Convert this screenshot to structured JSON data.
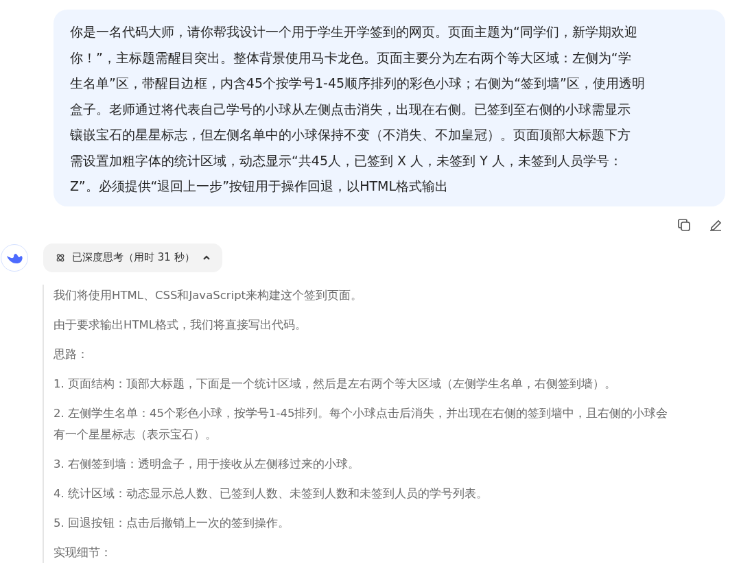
{
  "user_message": {
    "lines": [
      "你是一名代码大师，请你帮我设计一个用于学生开学签到的网页。页面主题为“同学们，新学期欢迎",
      "你！”，主标题需醒目突出。整体背景使用马卡龙色。页面主要分为左右两个等大区域：左侧为“学",
      "生名单”区，带醒目边框，内含45个按学号1-45顺序排列的彩色小球；右侧为“签到墙”区，使用透明",
      "盒子。老师通过将代表自己学号的小球从左侧点击消失，出现在右侧。已签到至右侧的小球需显示",
      "镶嵌宝石的星星标志，但左侧名单中的小球保持不变（不消失、不加皇冠）。页面顶部大标题下方",
      "需设置加粗字体的统计区域，动态显示“共45人，已签到 X 人，未签到 Y 人，未签到人员学号：",
      "Z”。必须提供“退回上一步”按钮用于操作回退，以HTML格式输出"
    ]
  },
  "thinking_toggle": {
    "label": "已深度思考（用时 31 秒）",
    "expanded": true
  },
  "thinking": [
    {
      "lines": [
        "我们将使用HTML、CSS和JavaScript来构建这个签到页面。"
      ]
    },
    {
      "lines": [
        "由于要求输出HTML格式，我们将直接写出代码。"
      ]
    },
    {
      "lines": [
        "思路："
      ]
    },
    {
      "lines": [
        "1. 页面结构：顶部大标题，下面是一个统计区域，然后是左右两个等大区域（左侧学生名单，右侧签到墙）。"
      ]
    },
    {
      "lines": [
        "2. 左侧学生名单：45个彩色小球，按学号1-45排列。每个小球点击后消失，并出现在右侧的签到墙中，且右侧的小球会",
        "有一个星星标志（表示宝石）。"
      ]
    },
    {
      "lines": [
        "3. 右侧签到墙：透明盒子，用于接收从左侧移过来的小球。"
      ]
    },
    {
      "lines": [
        "4. 统计区域：动态显示总人数、已签到人数、未签到人数和未签到人员的学号列表。"
      ]
    },
    {
      "lines": [
        "5. 回退按钮：点击后撤销上一次的签到操作。"
      ]
    },
    {
      "lines": [
        "实现细节："
      ]
    }
  ]
}
